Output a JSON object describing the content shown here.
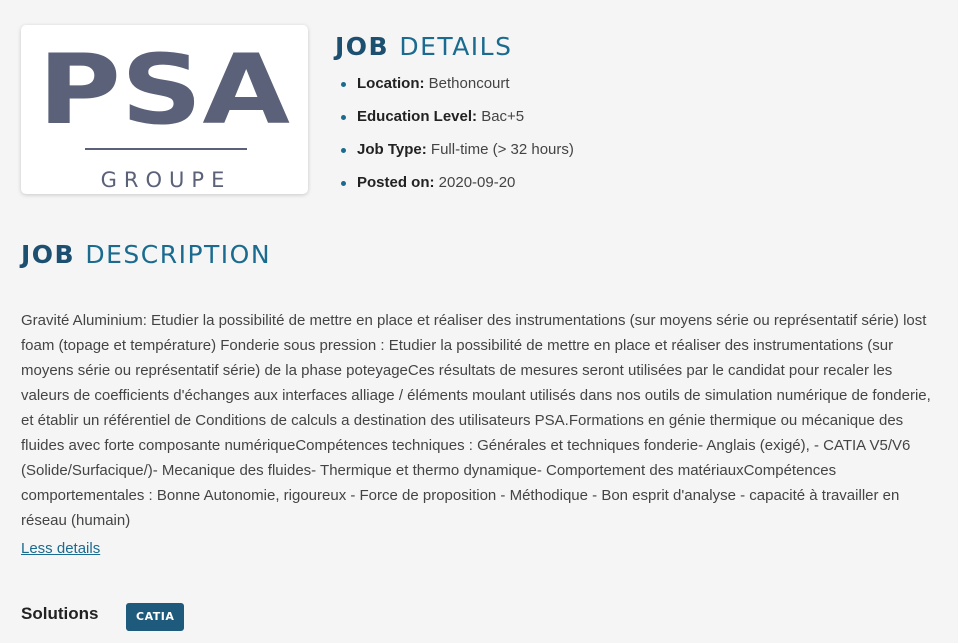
{
  "logo": {
    "wordmark": "PSA",
    "subtitle": "GROUPE"
  },
  "job_details": {
    "title_strong": "JOB",
    "title_light": "DETAILS",
    "items": [
      {
        "label": "Location:",
        "value": "Bethoncourt"
      },
      {
        "label": "Education Level:",
        "value": "Bac+5"
      },
      {
        "label": "Job Type:",
        "value": "Full-time (> 32 hours)"
      },
      {
        "label": "Posted on:",
        "value": "2020-09-20"
      }
    ]
  },
  "job_description": {
    "title_strong": "JOB",
    "title_light": "DESCRIPTION",
    "text": "Gravité Aluminium: Etudier la possibilité de mettre en place et réaliser des instrumentations (sur moyens série ou représentatif série) lost foam (topage et température) Fonderie sous pression : Etudier la possibilité de mettre en place et réaliser des instrumentations (sur moyens série ou représentatif série) de la phase poteyageCes résultats de mesures seront utilisées par le candidat pour recaler les valeurs de coefficients d'échanges aux interfaces alliage / éléments moulant utilisés dans nos outils de simulation numérique de fonderie, et établir un référentiel de Conditions de calculs a destination des utilisateurs PSA.Formations en génie thermique ou mécanique des fluides avec forte composante numériqueCompétences techniques : Générales et techniques fonderie- Anglais (exigé), - CATIA V5/V6 (Solide/Surfacique/)- Mecanique des fluides- Thermique et thermo dynamique- Comportement des matériauxCompétences comportementales : Bonne Autonomie, rigoureux - Force de proposition - Méthodique - Bon esprit d'analyse - capacité à travailler en réseau (humain)",
    "less_link": "Less details"
  },
  "solutions": {
    "label": "Solutions",
    "tags": [
      "CATIA"
    ]
  },
  "colors": {
    "accent": "#1a6b8f",
    "accent_dark": "#1d4f71",
    "tag_bg": "#1d5a7c",
    "logo_gray": "#5a6178"
  }
}
